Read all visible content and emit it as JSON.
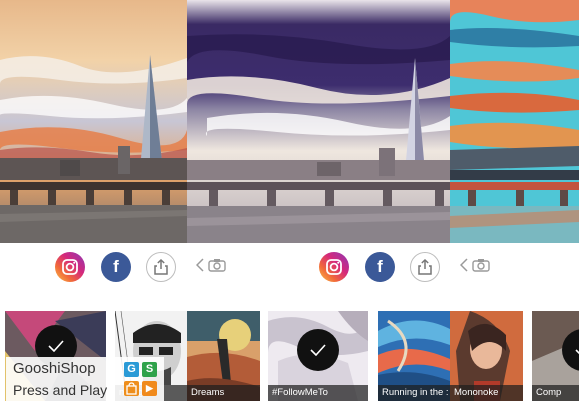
{
  "share_bar": {
    "left": {
      "instagram_icon": "instagram-icon",
      "facebook_label": "f",
      "share_icon": "share-icon",
      "camera_icon": "camera-icon",
      "back_icon": "chevron-left-icon"
    },
    "right": {
      "instagram_icon": "instagram-icon",
      "facebook_label": "f",
      "share_icon": "share-icon",
      "camera_icon": "camera-icon",
      "back_icon": "chevron-left-icon"
    }
  },
  "style_strip": {
    "items": [
      {
        "label": "",
        "selected": true
      },
      {
        "label": "nberg",
        "selected": false
      },
      {
        "label": "Dreams",
        "selected": false
      },
      {
        "label": "#FollowMeTo",
        "selected": true
      },
      {
        "label": "Running in the :",
        "selected": false
      },
      {
        "label": "Mononoke",
        "selected": false
      },
      {
        "label": "Comp",
        "selected": true
      }
    ]
  },
  "watermark": {
    "line1": "GooshiShop",
    "line2": "Press and Play",
    "tiles": [
      "G",
      "S",
      "",
      "▶"
    ]
  },
  "colors": {
    "facebook": "#3b5998",
    "check_circle": "#111111",
    "label_bar": "#1e1e1e"
  }
}
